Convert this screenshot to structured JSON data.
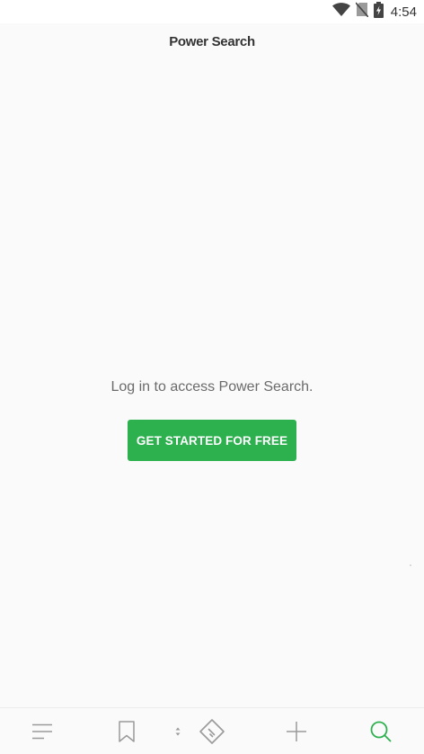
{
  "status_bar": {
    "time": "4:54",
    "icons": [
      "wifi-icon",
      "no-sim-icon",
      "battery-charging-icon"
    ]
  },
  "header": {
    "title": "Power Search"
  },
  "main": {
    "message": "Log in to access Power Search.",
    "cta_label": "GET STARTED FOR FREE"
  },
  "bottom_nav": {
    "items": [
      {
        "icon": "menu-icon",
        "active": false
      },
      {
        "icon": "bookmark-icon",
        "active": false
      },
      {
        "icon": "tag-icon",
        "active": false
      },
      {
        "icon": "plus-icon",
        "active": false
      },
      {
        "icon": "search-icon",
        "active": true
      }
    ]
  },
  "colors": {
    "accent": "#2db14f",
    "background": "#fafafa",
    "icon_inactive": "#9a9a9a"
  }
}
